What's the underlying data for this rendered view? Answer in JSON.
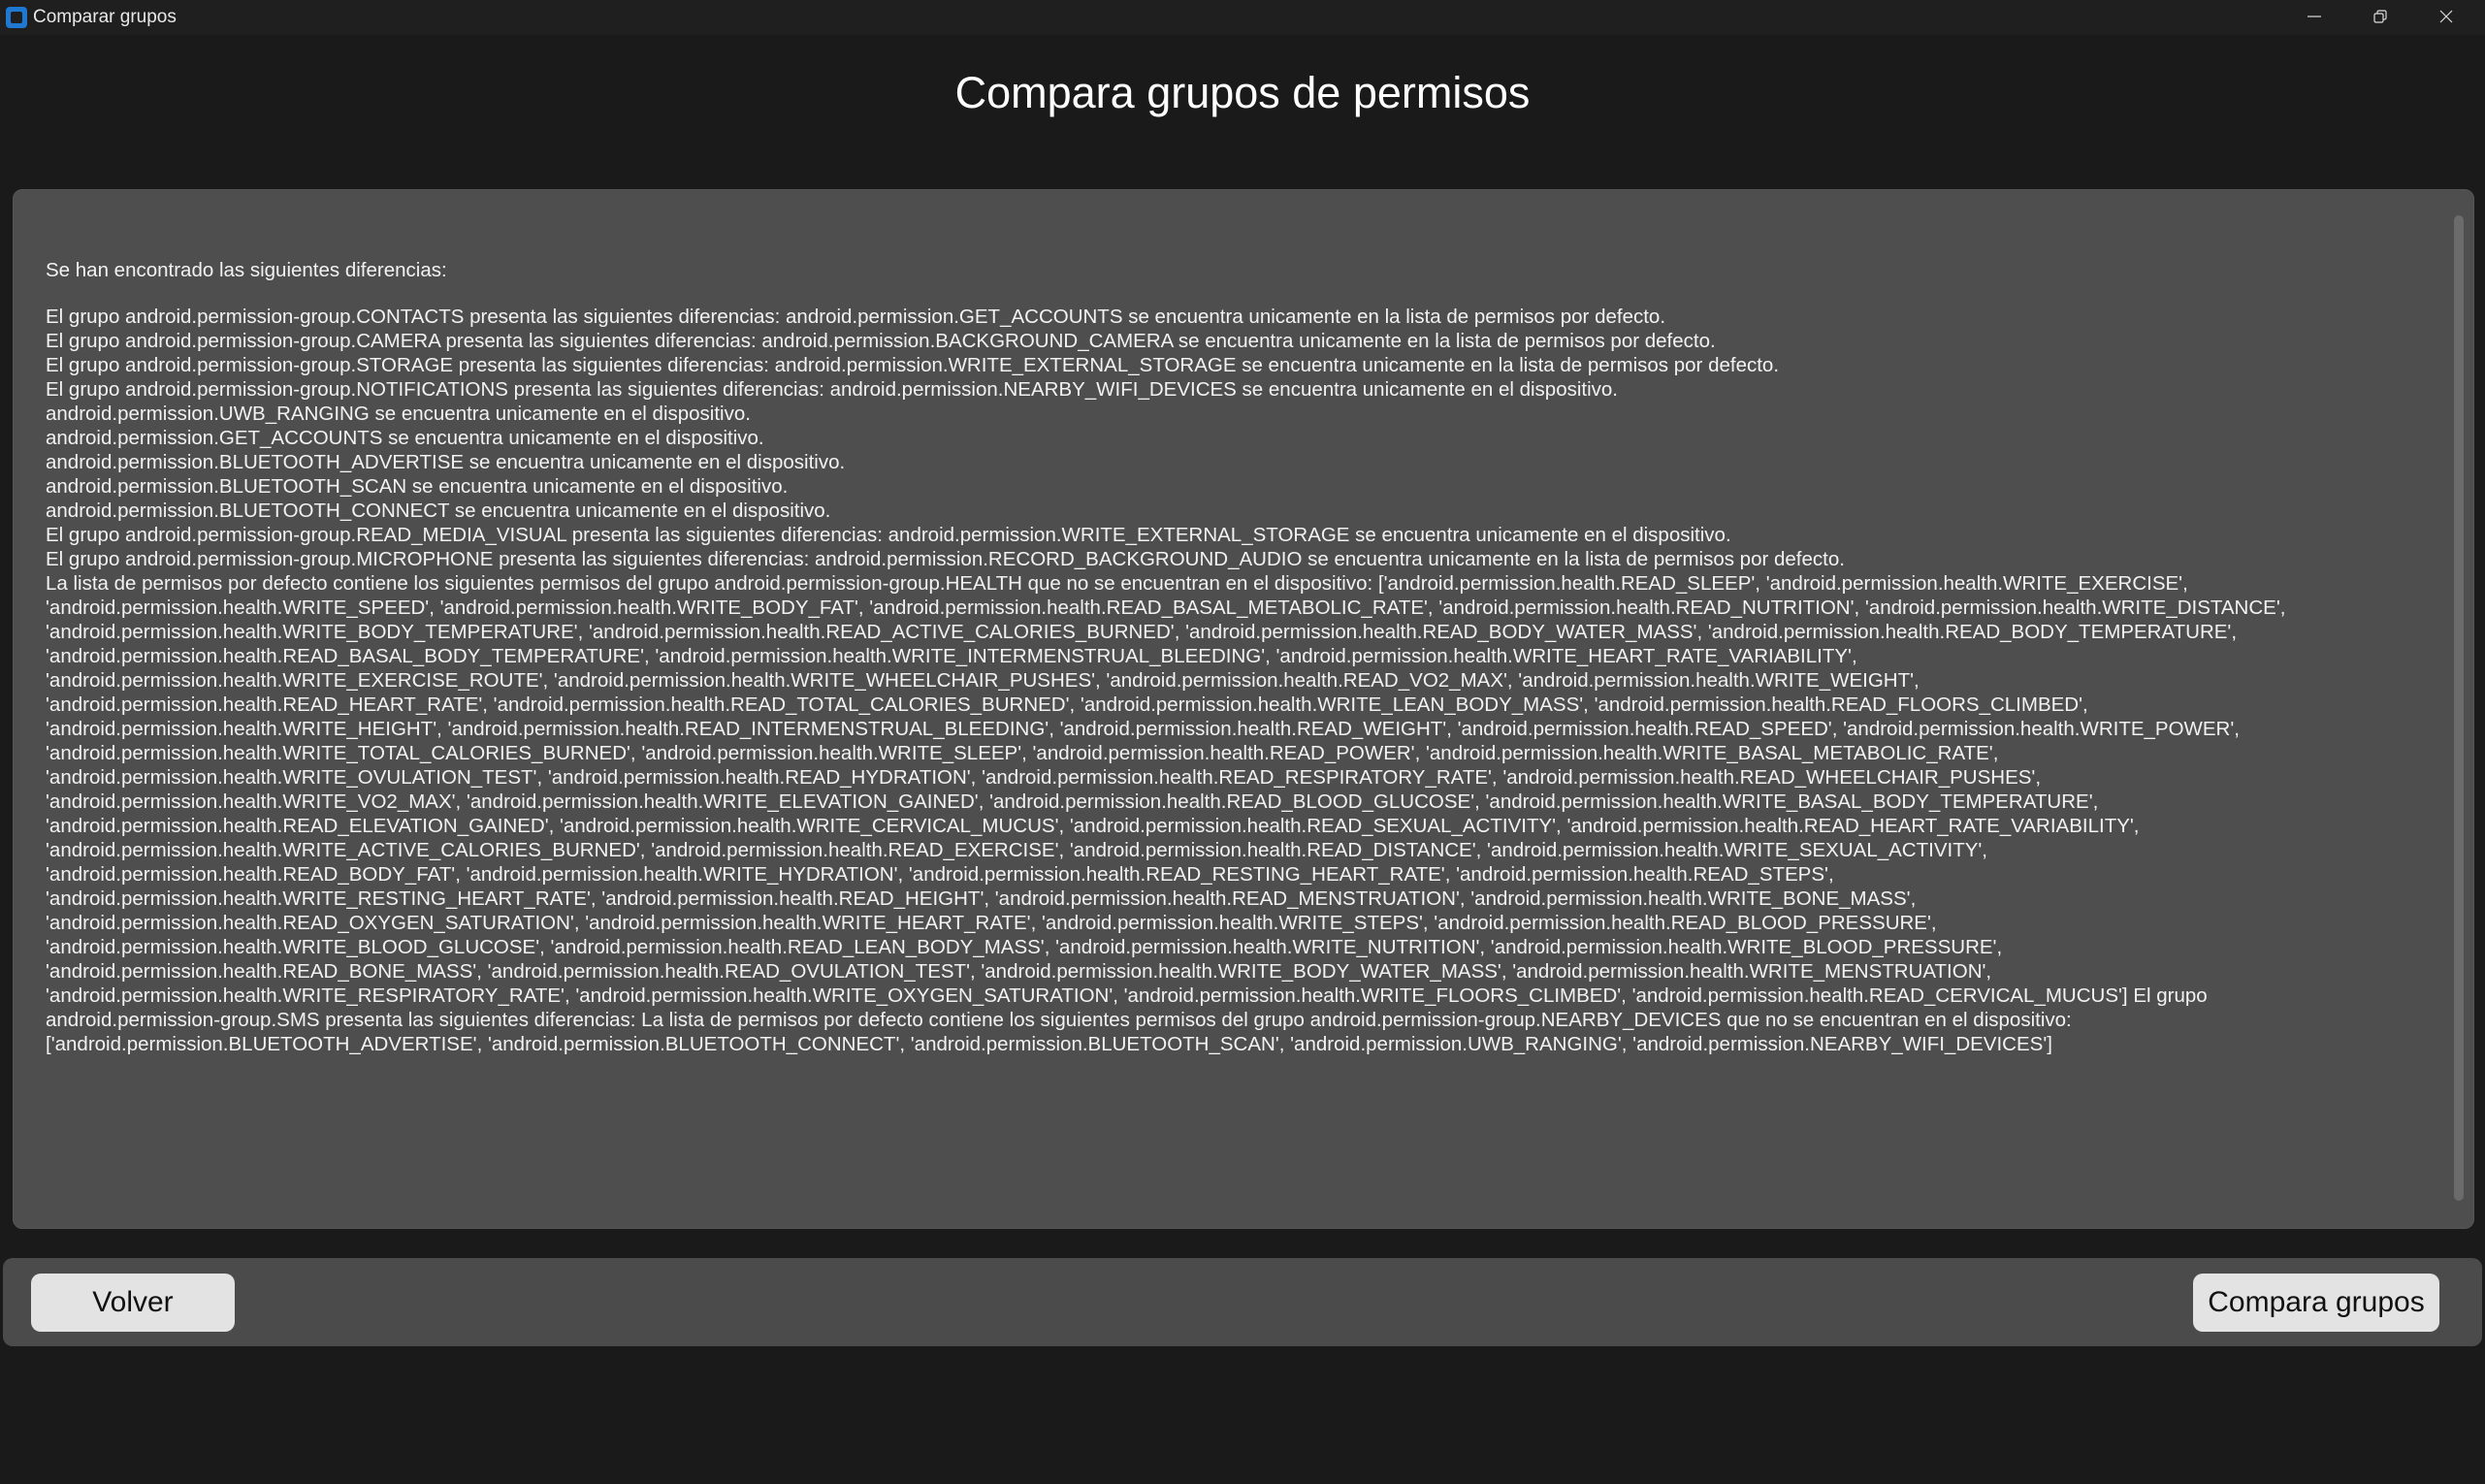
{
  "window": {
    "title": "Comparar grupos",
    "controls": {
      "minimize_icon": "minimize-icon",
      "maximize_icon": "restore-icon",
      "close_icon": "close-icon"
    }
  },
  "heading": "Compara grupos de permisos",
  "results": {
    "lines": [
      "Se han encontrado las siguientes diferencias:",
      "",
      "El grupo android.permission-group.CONTACTS presenta las siguientes diferencias: android.permission.GET_ACCOUNTS se encuentra unicamente en la lista de permisos por defecto.",
      "El grupo android.permission-group.CAMERA presenta las siguientes diferencias: android.permission.BACKGROUND_CAMERA se encuentra unicamente en la lista de permisos por defecto.",
      "El grupo android.permission-group.STORAGE presenta las siguientes diferencias: android.permission.WRITE_EXTERNAL_STORAGE se encuentra unicamente en la lista de permisos por defecto.",
      "El grupo android.permission-group.NOTIFICATIONS presenta las siguientes diferencias: android.permission.NEARBY_WIFI_DEVICES se encuentra unicamente en el dispositivo.",
      "android.permission.UWB_RANGING se encuentra unicamente en el dispositivo.",
      "android.permission.GET_ACCOUNTS se encuentra unicamente en el dispositivo.",
      "android.permission.BLUETOOTH_ADVERTISE se encuentra unicamente en el dispositivo.",
      "android.permission.BLUETOOTH_SCAN se encuentra unicamente en el dispositivo.",
      "android.permission.BLUETOOTH_CONNECT se encuentra unicamente en el dispositivo.",
      "El grupo android.permission-group.READ_MEDIA_VISUAL presenta las siguientes diferencias: android.permission.WRITE_EXTERNAL_STORAGE se encuentra unicamente en el dispositivo.",
      "El grupo android.permission-group.MICROPHONE presenta las siguientes diferencias: android.permission.RECORD_BACKGROUND_AUDIO se encuentra unicamente en la lista de permisos por defecto.",
      "La lista de permisos por defecto contiene los siguientes permisos del grupo android.permission-group.HEALTH que no se encuentran en el dispositivo: ['android.permission.health.READ_SLEEP', 'android.permission.health.WRITE_EXERCISE',",
      "'android.permission.health.WRITE_SPEED', 'android.permission.health.WRITE_BODY_FAT', 'android.permission.health.READ_BASAL_METABOLIC_RATE', 'android.permission.health.READ_NUTRITION', 'android.permission.health.WRITE_DISTANCE',",
      "'android.permission.health.WRITE_BODY_TEMPERATURE', 'android.permission.health.READ_ACTIVE_CALORIES_BURNED', 'android.permission.health.READ_BODY_WATER_MASS', 'android.permission.health.READ_BODY_TEMPERATURE',",
      "'android.permission.health.READ_BASAL_BODY_TEMPERATURE', 'android.permission.health.WRITE_INTERMENSTRUAL_BLEEDING', 'android.permission.health.WRITE_HEART_RATE_VARIABILITY',",
      "'android.permission.health.WRITE_EXERCISE_ROUTE', 'android.permission.health.WRITE_WHEELCHAIR_PUSHES', 'android.permission.health.READ_VO2_MAX', 'android.permission.health.WRITE_WEIGHT',",
      "'android.permission.health.READ_HEART_RATE', 'android.permission.health.READ_TOTAL_CALORIES_BURNED', 'android.permission.health.WRITE_LEAN_BODY_MASS', 'android.permission.health.READ_FLOORS_CLIMBED',",
      "'android.permission.health.WRITE_HEIGHT', 'android.permission.health.READ_INTERMENSTRUAL_BLEEDING', 'android.permission.health.READ_WEIGHT', 'android.permission.health.READ_SPEED', 'android.permission.health.WRITE_POWER',",
      "'android.permission.health.WRITE_TOTAL_CALORIES_BURNED', 'android.permission.health.WRITE_SLEEP', 'android.permission.health.READ_POWER', 'android.permission.health.WRITE_BASAL_METABOLIC_RATE',",
      "'android.permission.health.WRITE_OVULATION_TEST', 'android.permission.health.READ_HYDRATION', 'android.permission.health.READ_RESPIRATORY_RATE', 'android.permission.health.READ_WHEELCHAIR_PUSHES',",
      "'android.permission.health.WRITE_VO2_MAX', 'android.permission.health.WRITE_ELEVATION_GAINED', 'android.permission.health.READ_BLOOD_GLUCOSE', 'android.permission.health.WRITE_BASAL_BODY_TEMPERATURE',",
      "'android.permission.health.READ_ELEVATION_GAINED', 'android.permission.health.WRITE_CERVICAL_MUCUS', 'android.permission.health.READ_SEXUAL_ACTIVITY', 'android.permission.health.READ_HEART_RATE_VARIABILITY',",
      "'android.permission.health.WRITE_ACTIVE_CALORIES_BURNED', 'android.permission.health.READ_EXERCISE', 'android.permission.health.READ_DISTANCE', 'android.permission.health.WRITE_SEXUAL_ACTIVITY',",
      "'android.permission.health.READ_BODY_FAT', 'android.permission.health.WRITE_HYDRATION', 'android.permission.health.READ_RESTING_HEART_RATE', 'android.permission.health.READ_STEPS',",
      "'android.permission.health.WRITE_RESTING_HEART_RATE', 'android.permission.health.READ_HEIGHT', 'android.permission.health.READ_MENSTRUATION', 'android.permission.health.WRITE_BONE_MASS',",
      "'android.permission.health.READ_OXYGEN_SATURATION', 'android.permission.health.WRITE_HEART_RATE', 'android.permission.health.WRITE_STEPS', 'android.permission.health.READ_BLOOD_PRESSURE',",
      "'android.permission.health.WRITE_BLOOD_GLUCOSE', 'android.permission.health.READ_LEAN_BODY_MASS', 'android.permission.health.WRITE_NUTRITION', 'android.permission.health.WRITE_BLOOD_PRESSURE',",
      "'android.permission.health.READ_BONE_MASS', 'android.permission.health.READ_OVULATION_TEST', 'android.permission.health.WRITE_BODY_WATER_MASS', 'android.permission.health.WRITE_MENSTRUATION',",
      "'android.permission.health.WRITE_RESPIRATORY_RATE', 'android.permission.health.WRITE_OXYGEN_SATURATION', 'android.permission.health.WRITE_FLOORS_CLIMBED', 'android.permission.health.READ_CERVICAL_MUCUS'] El grupo",
      "android.permission-group.SMS presenta las siguientes diferencias: La lista de permisos por defecto contiene los siguientes permisos del grupo android.permission-group.NEARBY_DEVICES que no se encuentran en el dispositivo:",
      "['android.permission.BLUETOOTH_ADVERTISE', 'android.permission.BLUETOOTH_CONNECT', 'android.permission.BLUETOOTH_SCAN', 'android.permission.UWB_RANGING', 'android.permission.NEARBY_WIFI_DEVICES']"
    ]
  },
  "footer": {
    "back_label": "Volver",
    "compare_label": "Compara grupos"
  }
}
